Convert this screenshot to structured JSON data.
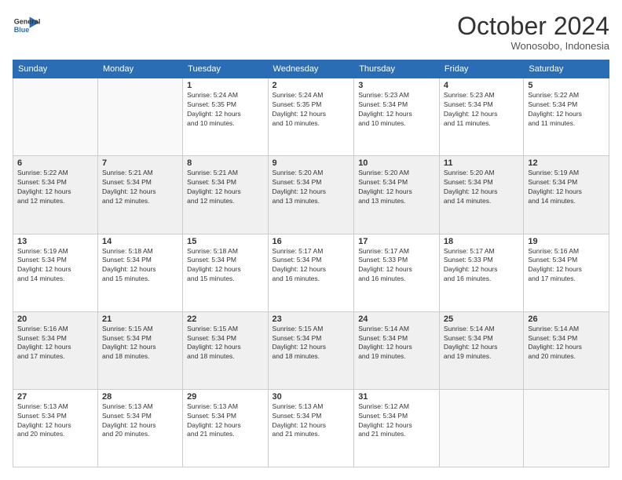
{
  "logo": {
    "line1": "General",
    "line2": "Blue"
  },
  "header": {
    "month": "October 2024",
    "location": "Wonosobo, Indonesia"
  },
  "weekdays": [
    "Sunday",
    "Monday",
    "Tuesday",
    "Wednesday",
    "Thursday",
    "Friday",
    "Saturday"
  ],
  "weeks": [
    [
      {
        "day": "",
        "info": ""
      },
      {
        "day": "",
        "info": ""
      },
      {
        "day": "1",
        "info": "Sunrise: 5:24 AM\nSunset: 5:35 PM\nDaylight: 12 hours\nand 10 minutes."
      },
      {
        "day": "2",
        "info": "Sunrise: 5:24 AM\nSunset: 5:35 PM\nDaylight: 12 hours\nand 10 minutes."
      },
      {
        "day": "3",
        "info": "Sunrise: 5:23 AM\nSunset: 5:34 PM\nDaylight: 12 hours\nand 10 minutes."
      },
      {
        "day": "4",
        "info": "Sunrise: 5:23 AM\nSunset: 5:34 PM\nDaylight: 12 hours\nand 11 minutes."
      },
      {
        "day": "5",
        "info": "Sunrise: 5:22 AM\nSunset: 5:34 PM\nDaylight: 12 hours\nand 11 minutes."
      }
    ],
    [
      {
        "day": "6",
        "info": "Sunrise: 5:22 AM\nSunset: 5:34 PM\nDaylight: 12 hours\nand 12 minutes."
      },
      {
        "day": "7",
        "info": "Sunrise: 5:21 AM\nSunset: 5:34 PM\nDaylight: 12 hours\nand 12 minutes."
      },
      {
        "day": "8",
        "info": "Sunrise: 5:21 AM\nSunset: 5:34 PM\nDaylight: 12 hours\nand 12 minutes."
      },
      {
        "day": "9",
        "info": "Sunrise: 5:20 AM\nSunset: 5:34 PM\nDaylight: 12 hours\nand 13 minutes."
      },
      {
        "day": "10",
        "info": "Sunrise: 5:20 AM\nSunset: 5:34 PM\nDaylight: 12 hours\nand 13 minutes."
      },
      {
        "day": "11",
        "info": "Sunrise: 5:20 AM\nSunset: 5:34 PM\nDaylight: 12 hours\nand 14 minutes."
      },
      {
        "day": "12",
        "info": "Sunrise: 5:19 AM\nSunset: 5:34 PM\nDaylight: 12 hours\nand 14 minutes."
      }
    ],
    [
      {
        "day": "13",
        "info": "Sunrise: 5:19 AM\nSunset: 5:34 PM\nDaylight: 12 hours\nand 14 minutes."
      },
      {
        "day": "14",
        "info": "Sunrise: 5:18 AM\nSunset: 5:34 PM\nDaylight: 12 hours\nand 15 minutes."
      },
      {
        "day": "15",
        "info": "Sunrise: 5:18 AM\nSunset: 5:34 PM\nDaylight: 12 hours\nand 15 minutes."
      },
      {
        "day": "16",
        "info": "Sunrise: 5:17 AM\nSunset: 5:34 PM\nDaylight: 12 hours\nand 16 minutes."
      },
      {
        "day": "17",
        "info": "Sunrise: 5:17 AM\nSunset: 5:33 PM\nDaylight: 12 hours\nand 16 minutes."
      },
      {
        "day": "18",
        "info": "Sunrise: 5:17 AM\nSunset: 5:33 PM\nDaylight: 12 hours\nand 16 minutes."
      },
      {
        "day": "19",
        "info": "Sunrise: 5:16 AM\nSunset: 5:34 PM\nDaylight: 12 hours\nand 17 minutes."
      }
    ],
    [
      {
        "day": "20",
        "info": "Sunrise: 5:16 AM\nSunset: 5:34 PM\nDaylight: 12 hours\nand 17 minutes."
      },
      {
        "day": "21",
        "info": "Sunrise: 5:15 AM\nSunset: 5:34 PM\nDaylight: 12 hours\nand 18 minutes."
      },
      {
        "day": "22",
        "info": "Sunrise: 5:15 AM\nSunset: 5:34 PM\nDaylight: 12 hours\nand 18 minutes."
      },
      {
        "day": "23",
        "info": "Sunrise: 5:15 AM\nSunset: 5:34 PM\nDaylight: 12 hours\nand 18 minutes."
      },
      {
        "day": "24",
        "info": "Sunrise: 5:14 AM\nSunset: 5:34 PM\nDaylight: 12 hours\nand 19 minutes."
      },
      {
        "day": "25",
        "info": "Sunrise: 5:14 AM\nSunset: 5:34 PM\nDaylight: 12 hours\nand 19 minutes."
      },
      {
        "day": "26",
        "info": "Sunrise: 5:14 AM\nSunset: 5:34 PM\nDaylight: 12 hours\nand 20 minutes."
      }
    ],
    [
      {
        "day": "27",
        "info": "Sunrise: 5:13 AM\nSunset: 5:34 PM\nDaylight: 12 hours\nand 20 minutes."
      },
      {
        "day": "28",
        "info": "Sunrise: 5:13 AM\nSunset: 5:34 PM\nDaylight: 12 hours\nand 20 minutes."
      },
      {
        "day": "29",
        "info": "Sunrise: 5:13 AM\nSunset: 5:34 PM\nDaylight: 12 hours\nand 21 minutes."
      },
      {
        "day": "30",
        "info": "Sunrise: 5:13 AM\nSunset: 5:34 PM\nDaylight: 12 hours\nand 21 minutes."
      },
      {
        "day": "31",
        "info": "Sunrise: 5:12 AM\nSunset: 5:34 PM\nDaylight: 12 hours\nand 21 minutes."
      },
      {
        "day": "",
        "info": ""
      },
      {
        "day": "",
        "info": ""
      }
    ]
  ]
}
